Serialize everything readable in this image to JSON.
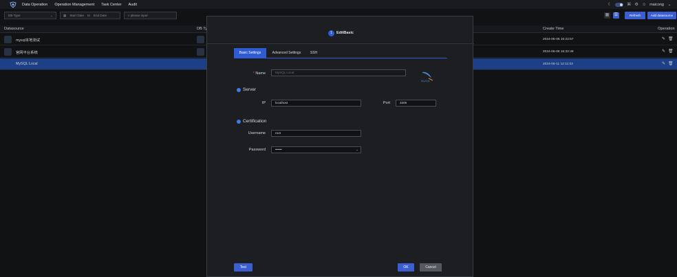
{
  "nav": {
    "menu": [
      "Data Operation",
      "Operation Management",
      "Task Center",
      "Audit"
    ],
    "user": "maicong"
  },
  "filters": {
    "db_type_placeholder": "DB Type",
    "start_date": "Start Date",
    "to": "to",
    "end_date": "End Date",
    "search_placeholder": "please input",
    "refresh_label": "Refresh",
    "add_label": "Add datasource"
  },
  "table": {
    "columns": {
      "datasource": "Datasource",
      "db_type": "DB Ty",
      "create_time": "Create Time",
      "operation": "Operation"
    },
    "rows": [
      {
        "name": "mysql本地测试",
        "time": "2024-06-06 10:22:57"
      },
      {
        "name": "官网平台系统",
        "time": "2024-06-06 16:32:48"
      },
      {
        "name": "MySQL Local",
        "time": "2024-06-11 12:11:03"
      }
    ]
  },
  "modal": {
    "step_number": "1",
    "step_label": "EditBasic",
    "tabs": [
      "Basic Settings",
      "Advanced Settings",
      "SSH"
    ],
    "name_label": "Name",
    "name_required_mark": "*",
    "name_value": "MySQL Local",
    "server_section": "Server",
    "ip_label": "IP",
    "ip_value": "localhost",
    "port_label": "Port",
    "port_value": "3306",
    "cert_section": "Certification",
    "username_label": "Username",
    "username_value": "root",
    "password_label": "Password",
    "password_value": "••••••",
    "test_label": "Test",
    "ok_label": "OK",
    "cancel_label": "Cancel"
  },
  "colors": {
    "primary": "#3b5fd0",
    "selected_row": "#1d3f86"
  }
}
